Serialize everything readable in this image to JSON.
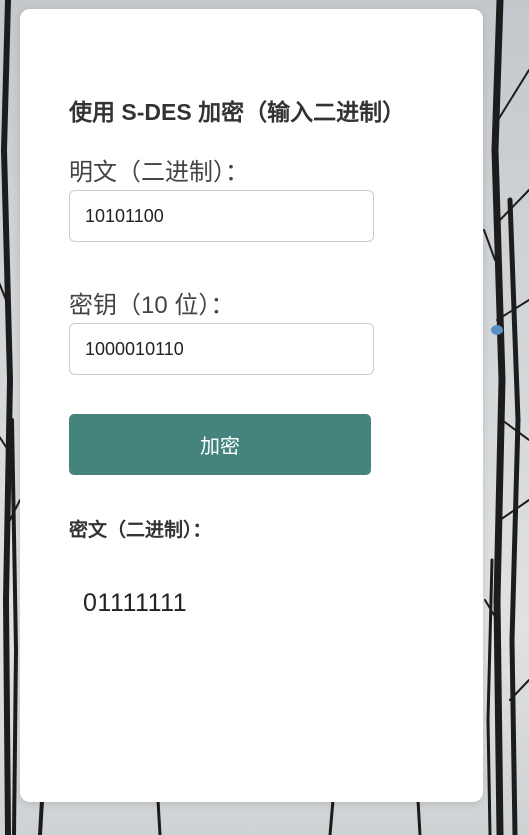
{
  "form": {
    "heading": "使用 S-DES 加密（输入二进制）",
    "plaintext_label": "明文（二进制）：",
    "plaintext_value": "10101100",
    "key_label": "密钥（10 位）：",
    "key_value": "1000010110",
    "encrypt_button_label": "加密",
    "ciphertext_label": "密文（二进制）：",
    "ciphertext_value": "01111111"
  },
  "colors": {
    "button_background": "#44847d",
    "card_background": "#ffffff"
  }
}
